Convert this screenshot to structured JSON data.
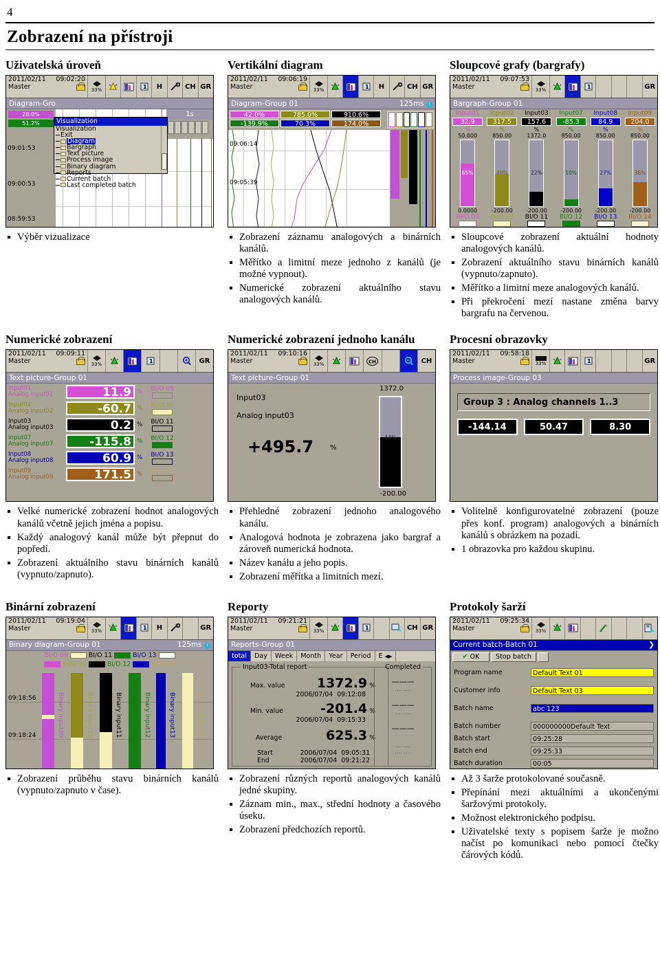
{
  "page": {
    "number": "4",
    "title": "Zobrazení na přístroji"
  },
  "sections": [
    {
      "heading": "Uživatelská úroveň",
      "bullets": [
        "Výběr vizualizace"
      ]
    },
    {
      "heading": "Vertikální diagram",
      "bullets": [
        "Zobrazení záznamu analogových a binárních kanálů.",
        "Měřítko a limitní meze jednoho z kanálů (je možné vypnout).",
        "Numerické zobrazení aktuálního stavu analogových kanálů."
      ]
    },
    {
      "heading": "Sloupcové grafy  (bargrafy)",
      "bullets": [
        "Sloupcové zobrazení aktuální hodnoty analogových kanálů.",
        "Zobrazení aktuálního stavu binárních kanálů (vypnuto/zapnuto).",
        "Měřítko a limitní meze analogových kanálů.",
        "Při překročení mezí nastane změna barvy bargrafu na červenou."
      ]
    },
    {
      "heading": "Numerické zobrazení",
      "bullets": [
        "Velké numerické zobrazení hodnot analogových kanálů včetně jejich jména a popisu.",
        "Každý analogový kanál může být přepnut do popředí.",
        "Zobrazení aktuálního stavu binárních kanálů (vypnuto/zapnuto)."
      ]
    },
    {
      "heading": "Numerické zobrazení jednoho kanálu",
      "bullets": [
        "Přehledné zobrazení jednoho analogového kanálu.",
        "Analogová hodnota je zobrazena jako bargraf a zároveň numerická hodnota.",
        "Název kanálu a jeho popis.",
        "Zobrazení měřítka a limitních mezí."
      ]
    },
    {
      "heading": "Procesní obrazovky",
      "bullets": [
        "Volitelně konfigurovatelné zobrazení (pouze přes konf. program) analogových a binárních kanálů s obrázkem na pozadí.",
        "1 obrazovka pro každou skupinu."
      ]
    },
    {
      "heading": "Binární zobrazení",
      "bullets": [
        "Zobrazení průběhu stavu binárních kanálů (vypnuto/zapnuto v čase)."
      ]
    },
    {
      "heading": "Reporty",
      "bullets": [
        "Zobrazení různých reportů analogových kanálů jedné skupiny.",
        "Záznam min., max., střední hodnoty a časového úseku.",
        "Zobrazení předchozích reportů."
      ]
    },
    {
      "heading": "Protokoly šarží",
      "bullets": [
        "Až 3 šarže protokolované současně.",
        "Přepínání mezi aktuálními a ukončenými šaržovými protokoly.",
        "Možnost elektronického podpisu.",
        "Uživatelské texty s popisem šarže je možno načíst po komunikaci nebo pomocí čtečky čárových kódů."
      ]
    }
  ],
  "shot_visualization": {
    "date": "2011/02/11",
    "time": "09:02:20",
    "user": "Master",
    "memory": "33%",
    "toolbar": [
      "home-icon",
      "bell-icon",
      "diagram-icon",
      "group-icon",
      "history-icon",
      "tools-icon",
      "ch-icon",
      "gr-icon"
    ],
    "group_label": "Diagram-Gro",
    "chip1": "28.0%",
    "chip2": "51.2%",
    "times": [
      "09:01:53",
      "09:00:53",
      "08:59:53"
    ],
    "interval": "1s",
    "menu_title": "Visualization",
    "menu_items": [
      "Visualization",
      "Exit",
      "Diagram",
      "Bargraph",
      "Text picture",
      "Process image",
      "Binary diagram",
      "Reports",
      "Current batch",
      "Last completed batch"
    ],
    "menu_selected": "Diagram"
  },
  "shot_vdiagram": {
    "date": "2011/02/11",
    "time": "09:06:19",
    "user": "Master",
    "memory": "33%",
    "group_label": "Diagram-Group 01",
    "interval": "125ms",
    "values": [
      {
        "text": "42.0%",
        "color": "#d34fd3"
      },
      {
        "text": "785.0%",
        "color": "#8d8a1a"
      },
      {
        "text": "910.6%",
        "color": "#000000"
      },
      {
        "text": "-139.9%",
        "color": "#1a7a1a"
      },
      {
        "text": "70.3%",
        "color": "#0000b4"
      },
      {
        "text": "174.0%",
        "color": "#8a5a15"
      }
    ],
    "times": [
      "09:06:14",
      "09:05:39"
    ]
  },
  "shot_bargraph": {
    "date": "2011/02/11",
    "time": "09:07:53",
    "user": "Master",
    "memory": "33%",
    "group_label": "Bargraph-Group 01",
    "unit": "%",
    "channels": [
      {
        "name": "Input01",
        "value": "32.9",
        "max": "50.000",
        "min": "0.0000",
        "pct": "65%",
        "pct_num": 65,
        "bio": "BI/O 09",
        "color": "#d34fd3"
      },
      {
        "name": "Input02",
        "value": "317.5",
        "max": "850.00",
        "min": "-200.00",
        "pct": "49%",
        "pct_num": 49,
        "bio": "BI/O 10",
        "color": "#8d8a1a"
      },
      {
        "name": "Input03",
        "value": "157.6",
        "max": "1372.0",
        "min": "-200.00",
        "pct": "22%",
        "pct_num": 22,
        "bio": "BI/O 11",
        "color": "#000000"
      },
      {
        "name": "Input07",
        "value": "-85.3",
        "max": "850.00",
        "min": "-200.00",
        "pct": "10%",
        "pct_num": 10,
        "bio": "BI/O 12",
        "color": "#128012"
      },
      {
        "name": "Input08",
        "value": "84.9",
        "max": "850.00",
        "min": "-200.00",
        "pct": "27%",
        "pct_num": 27,
        "bio": "BI/O 13",
        "color": "#0000c8"
      },
      {
        "name": "Input09",
        "value": "204.0",
        "max": "850.00",
        "min": "-200.00",
        "pct": "36%",
        "pct_num": 36,
        "bio": "BI/O 14",
        "color": "#a0601a"
      }
    ]
  },
  "shot_numeric": {
    "date": "2011/02/11",
    "time": "09:09:11",
    "user": "Master",
    "memory": "33%",
    "group_label": "Text picture-Group 01",
    "unit": "%",
    "rows": [
      {
        "name": "Input01",
        "desc": "Analog input01",
        "value": "11.9",
        "bio": "BI/O 09",
        "color": "#d34fd3"
      },
      {
        "name": "Input02",
        "desc": "Analog input02",
        "value": "-60.7",
        "bio": "BI/O 10",
        "color": "#8d8a1a"
      },
      {
        "name": "Input03",
        "desc": "Analog input03",
        "value": "0.2",
        "bio": "BI/O 11",
        "color": "#000000"
      },
      {
        "name": "Input07",
        "desc": "Analog input07",
        "value": "-115.8",
        "bio": "BI/O 12",
        "color": "#128012"
      },
      {
        "name": "Input08",
        "desc": "Analog input08",
        "value": "60.9",
        "bio": "BI/O 13",
        "color": "#0000b4"
      },
      {
        "name": "Input09",
        "desc": "Analog input09",
        "value": "171.5",
        "bio": "BI/O 14",
        "color": "#a0601a"
      }
    ]
  },
  "shot_single": {
    "date": "2011/02/11",
    "time": "09:10:16",
    "user": "Master",
    "memory": "33%",
    "group_label": "Text picture-Group 01",
    "channel_name": "Input03",
    "channel_desc": "Analog input03",
    "value": "+495.7",
    "unit": "%",
    "max": "1372.0",
    "min": "-200.00",
    "pct": "44%",
    "pct_num": 44
  },
  "shot_process": {
    "date": "2011/02/11",
    "time": "09:58:18",
    "user": "Master",
    "memory": "33%",
    "group_label": "Process image-Group 03",
    "title": "Group 3 : Analog channels 1..3",
    "values": [
      "-144.14",
      "50.47",
      "8.30"
    ]
  },
  "shot_binary": {
    "date": "2011/02/11",
    "time": "09:19:04",
    "user": "Master",
    "memory": "33%",
    "group_label": "Binary diagram-Group 01",
    "interval": "125ms",
    "legend_top": [
      {
        "label": "BI/O 09",
        "color": "#d34fd3"
      },
      {
        "label": "BI/O 11",
        "color": "#000000"
      },
      {
        "label": "BI/O 13",
        "color": "#0000b4"
      }
    ],
    "legend_bottom": [
      {
        "label": "BI/O 10",
        "color": "#8d8a1a"
      },
      {
        "label": "BI/O 12",
        "color": "#128012"
      },
      {
        "label": "BI/O 14",
        "color": "#a0601a"
      }
    ],
    "times": [
      "09:18:56",
      "09:18:24"
    ],
    "tracks": [
      {
        "label": "Binary input09",
        "color": "#c24fd4"
      },
      {
        "label": "Binary input10",
        "color": "#8d8a1a"
      },
      {
        "label": "Binary input11",
        "color": "#000000"
      },
      {
        "label": "Binary input12",
        "color": "#128012"
      },
      {
        "label": "Binary input13",
        "color": "#0000b4"
      },
      {
        "label": "Binary input14",
        "color": "#a0601a"
      }
    ]
  },
  "shot_reports": {
    "date": "2011/02/11",
    "time": "09:21:21",
    "user": "Master",
    "memory": "33%",
    "group_label": "Reports-Group 01",
    "tabs": [
      "total",
      "Day",
      "Week",
      "Month",
      "Year",
      "Period",
      "E"
    ],
    "selected_tab": "total",
    "fieldset_label": "Input03-Total report",
    "completed_label": "Completed",
    "unit": "%",
    "max_label": "Max. value",
    "max_value": "1372.9",
    "max_date": "2006/07/04",
    "max_time": "09:12:08",
    "min_label": "Min. value",
    "min_value": "-201.4",
    "min_date": "2006/07/04",
    "min_time": "09:15:33",
    "avg_label": "Average",
    "avg_value": "625.3",
    "start_label": "Start",
    "start_date": "2006/07/04",
    "start_time": "09:05:31",
    "end_label": "End",
    "end_date": "2006/07/04",
    "end_time": "09:21:22"
  },
  "shot_batch": {
    "date": "2011/02/11",
    "time": "09:25:34",
    "user": "Master",
    "memory": "33%",
    "group_label": "Current batch-Batch 01",
    "ok_button": "OK",
    "stop_button": "Stop batch",
    "rows": [
      {
        "label": "Program name",
        "value": "Default Text 01",
        "style": "fld-yellow"
      },
      {
        "label": "Customer info",
        "value": "Default Text 03",
        "style": "fld-yellow"
      },
      {
        "label": "Batch name",
        "value": "abc 123",
        "style": "fld-blue"
      },
      {
        "label": "Batch number",
        "value": "000000000Default Text",
        "style": "fld-grey"
      },
      {
        "label": "Batch start",
        "value": "09:25:28",
        "style": "fld-grey"
      },
      {
        "label": "Batch end",
        "value": "09:25:33",
        "style": "fld-grey"
      },
      {
        "label": "Batch duration",
        "value": "00:05",
        "style": "fld-grey"
      }
    ]
  }
}
